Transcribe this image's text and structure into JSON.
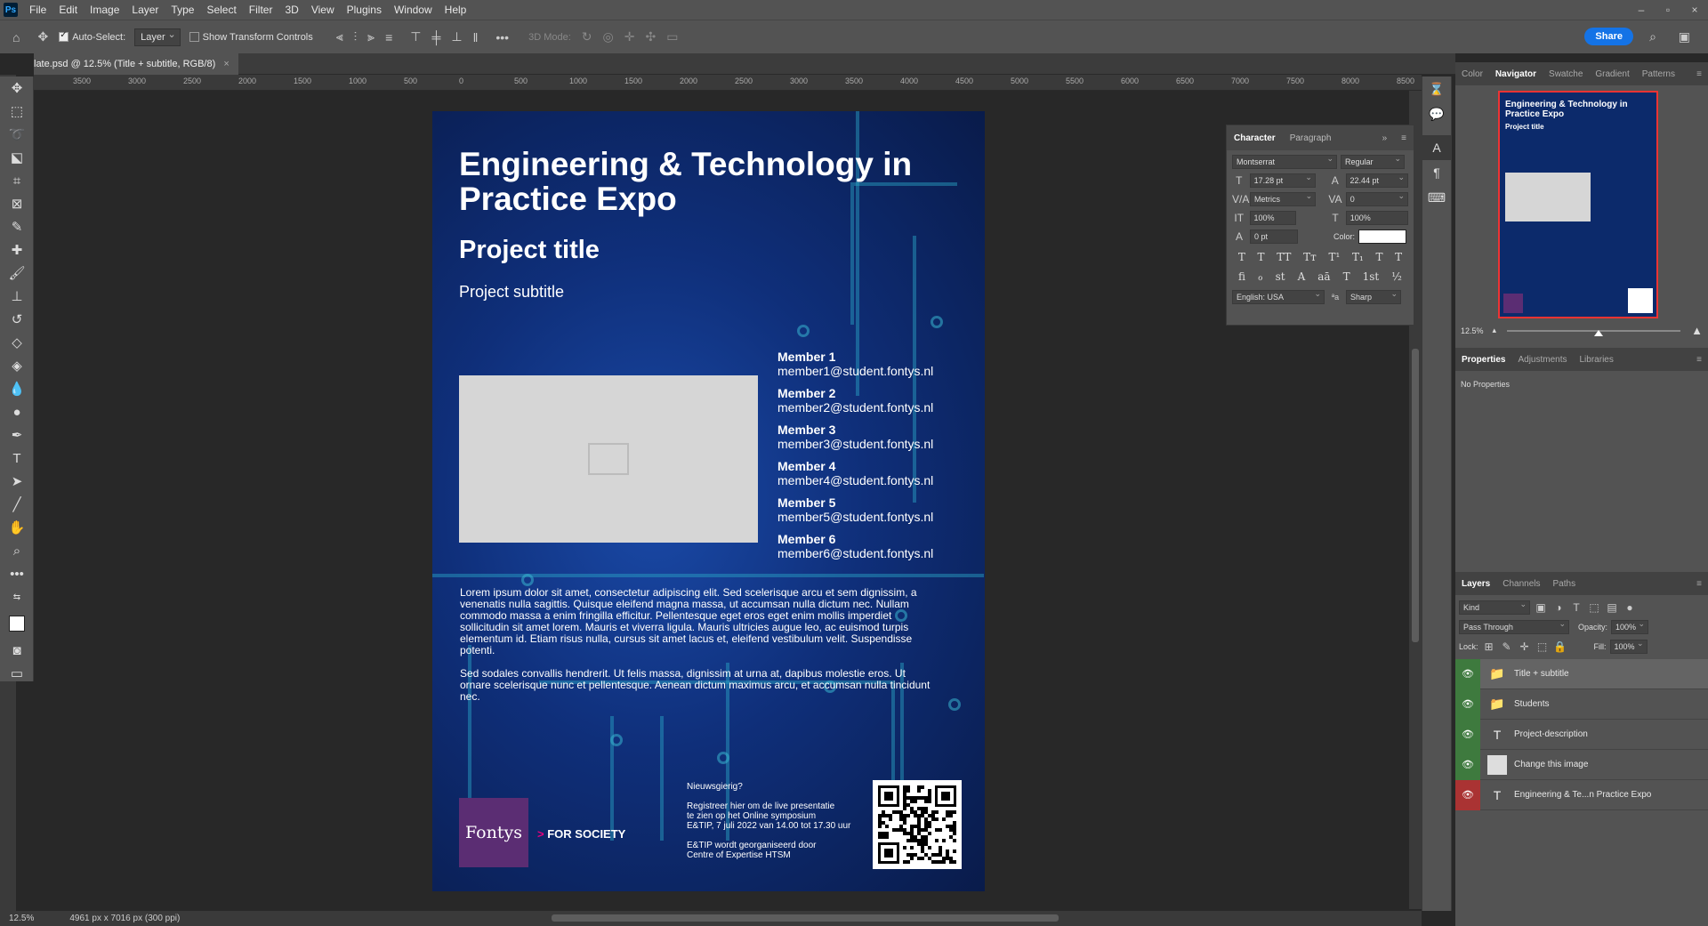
{
  "app": {
    "logo": "Ps"
  },
  "menu": [
    "File",
    "Edit",
    "Image",
    "Layer",
    "Type",
    "Select",
    "Filter",
    "3D",
    "View",
    "Plugins",
    "Window",
    "Help"
  ],
  "window_controls": [
    "–",
    "▫",
    "×"
  ],
  "options": {
    "auto_select_label": "Auto-Select:",
    "auto_select_value": "Layer",
    "show_transform_label": "Show Transform Controls",
    "mode_label": "3D Mode:",
    "share_label": "Share"
  },
  "document": {
    "tab_title": "late.psd @ 12.5% (Title + subtitle, RGB/8)",
    "close": "×"
  },
  "ruler_labels": [
    "3500",
    "3000",
    "2500",
    "2000",
    "1500",
    "1000",
    "500",
    "0",
    "500",
    "1000",
    "1500",
    "2000",
    "2500",
    "3000",
    "3500",
    "4000",
    "4500",
    "5000",
    "5500",
    "6000",
    "6500",
    "7000",
    "7500",
    "8000",
    "8500"
  ],
  "poster": {
    "title": "Engineering & Technology in Practice Expo",
    "project_title": "Project title",
    "project_subtitle": "Project subtitle",
    "members": [
      {
        "name": "Member 1",
        "email": "member1@student.fontys.nl"
      },
      {
        "name": "Member 2",
        "email": "member2@student.fontys.nl"
      },
      {
        "name": "Member 3",
        "email": "member3@student.fontys.nl"
      },
      {
        "name": "Member 4",
        "email": "member4@student.fontys.nl"
      },
      {
        "name": "Member 5",
        "email": "member5@student.fontys.nl"
      },
      {
        "name": "Member 6",
        "email": "member6@student.fontys.nl"
      }
    ],
    "description_1": "Lorem ipsum dolor sit amet, consectetur adipiscing elit. Sed scelerisque arcu et sem dignissim, a venenatis nulla sagittis. Quisque eleifend magna massa, ut accumsan nulla dictum nec. Nullam commodo massa a enim fringilla efficitur. Pellentesque eget eros eget enim mollis imperdiet sollicitudin sit amet lorem. Mauris et viverra ligula. Mauris ultricies augue leo, ac euismod turpis elementum id. Etiam risus nulla, cursus sit amet lacus et, eleifend vestibulum velit. Suspendisse potenti.",
    "description_2": "Sed sodales convallis hendrerit. Ut felis massa, dignissim at urna at, dapibus molestie eros. Ut ornare scelerisque nunc et pellentesque. Aenean dictum maximus arcu, et accumsan nulla tincidunt nec.",
    "logo_text": "Fontys",
    "society_arrow": ">",
    "society": "FOR SOCIETY",
    "info_heading": "Nieuwsgierig?",
    "info_line1": "Registreer hier om de live presentatie",
    "info_line2": "te zien op het Online symposium",
    "info_line3": "E&TIP, 7 juli 2022 van 14.00 tot 17.30 uur",
    "info_line4": "E&TIP wordt georganiseerd door",
    "info_line5": "Centre of Expertise HTSM"
  },
  "character": {
    "tab1": "Character",
    "tab2": "Paragraph",
    "font": "Montserrat",
    "style": "Regular",
    "size": "17.28 pt",
    "leading": "22.44 pt",
    "kerning": "Metrics",
    "tracking": "0",
    "vscale": "100%",
    "hscale": "100%",
    "baseline": "0 pt",
    "color_label": "Color:",
    "language": "English: USA",
    "aa_label": "ªa",
    "antialias": "Sharp",
    "style_glyphs": [
      "T",
      "T",
      "TT",
      "Tт",
      "T¹",
      "T₁",
      "T",
      "T"
    ],
    "opentype_glyphs": [
      "ﬁ",
      "ℴ",
      "st",
      "A",
      "aā",
      "T",
      "1st",
      "½"
    ]
  },
  "navigator": {
    "tabs": [
      "Color",
      "Navigator",
      "Swatche",
      "Gradient",
      "Patterns"
    ],
    "zoom": "12.5%",
    "thumb_title": "Engineering & Technology in Practice Expo",
    "thumb_subtitle": "Project title"
  },
  "properties": {
    "tabs": [
      "Properties",
      "Adjustments",
      "Libraries"
    ],
    "empty": "No Properties"
  },
  "layers": {
    "tabs": [
      "Layers",
      "Channels",
      "Paths"
    ],
    "filter": "Kind",
    "blend": "Pass Through",
    "opacity_label": "Opacity:",
    "opacity": "100%",
    "lock_label": "Lock:",
    "fill_label": "Fill:",
    "fill": "100%",
    "rows": [
      {
        "name": "Title + subtitle",
        "kind": "group",
        "color": "#3e7a3e"
      },
      {
        "name": "Students",
        "kind": "group",
        "color": "#3e7a3e"
      },
      {
        "name": "Project-description",
        "kind": "text",
        "color": "#3e7a3e"
      },
      {
        "name": "Change this image",
        "kind": "image",
        "color": "#3e7a3e"
      },
      {
        "name": "Engineering & Te...n Practice Expo",
        "kind": "text",
        "color": "#a33"
      }
    ]
  },
  "status": {
    "zoom": "12.5%",
    "dims": "4961 px x 7016 px (300 ppi)"
  }
}
